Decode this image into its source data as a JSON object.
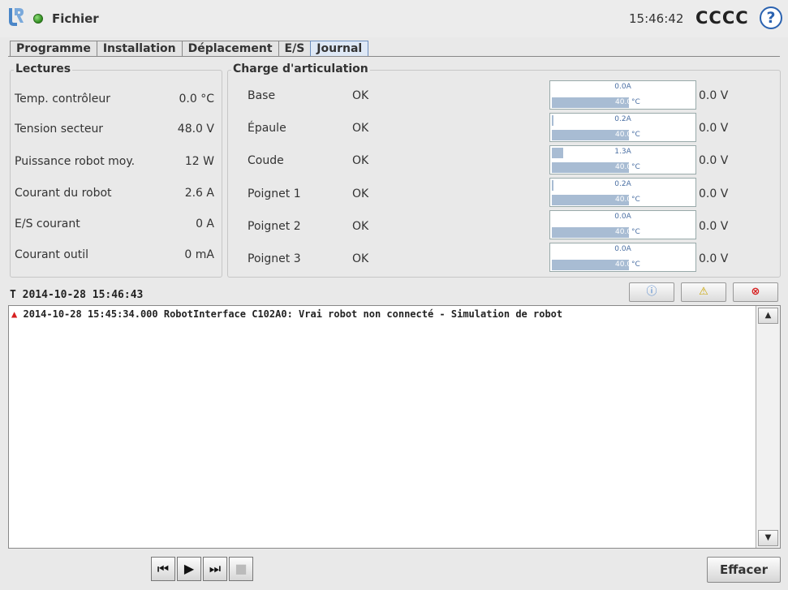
{
  "header": {
    "file_label": "Fichier",
    "clock": "15:46:42",
    "robot_name": "CCCC",
    "help_symbol": "?"
  },
  "tabs": [
    {
      "label": "Programme"
    },
    {
      "label": "Installation"
    },
    {
      "label": "Déplacement"
    },
    {
      "label": "E/S"
    },
    {
      "label": "Journal",
      "active": true
    }
  ],
  "readings": {
    "title": "Lectures",
    "items": [
      {
        "label": "Temp. contrôleur",
        "value": "0.0 °C"
      },
      {
        "label": "Tension secteur",
        "value": "48.0  V"
      },
      {
        "label": "Puissance robot moy.",
        "value": "12  W"
      },
      {
        "label": "Courant du robot",
        "value": "2.6  A"
      },
      {
        "label": "E/S courant",
        "value": "0  A"
      },
      {
        "label": "Courant outil",
        "value": "0 mA"
      }
    ]
  },
  "joints": {
    "title": "Charge d'articulation",
    "items": [
      {
        "name": "Base",
        "status": "OK",
        "current": "0.0A",
        "current_level": 0.0,
        "temp": "40.0",
        "temp_unit": "°C",
        "voltage": "0.0 V"
      },
      {
        "name": "Épaule",
        "status": "OK",
        "current": "0.2A",
        "current_level": 0.01,
        "temp": "40.0",
        "temp_unit": "°C",
        "voltage": "0.0 V"
      },
      {
        "name": "Coude",
        "status": "OK",
        "current": "1.3A",
        "current_level": 0.08,
        "temp": "40.0",
        "temp_unit": "°C",
        "voltage": "0.0 V"
      },
      {
        "name": "Poignet 1",
        "status": "OK",
        "current": "0.2A",
        "current_level": 0.01,
        "temp": "40.0",
        "temp_unit": "°C",
        "voltage": "0.0 V"
      },
      {
        "name": "Poignet 2",
        "status": "OK",
        "current": "0.0A",
        "current_level": 0.0,
        "temp": "40.0",
        "temp_unit": "°C",
        "voltage": "0.0 V"
      },
      {
        "name": "Poignet 3",
        "status": "OK",
        "current": "0.0A",
        "current_level": 0.0,
        "temp": "40.0",
        "temp_unit": "°C",
        "voltage": "0.0 V"
      }
    ]
  },
  "log": {
    "header": "T 2014-10-28 15:46:43",
    "filters": {
      "info": "ⓘ",
      "warning": "⚠",
      "error": "⊗"
    },
    "entries": [
      {
        "text": "2014-10-28 15:45:34.000 RobotInterface C102A0: Vrai robot non connecté - Simulation de robot",
        "level": "warning"
      }
    ]
  },
  "footer": {
    "clear_label": "Effacer"
  },
  "colors": {
    "accent": "#2a62b0",
    "status_ok": "#2e8b1e",
    "bar": "#a8bcd3",
    "error": "#d62020"
  }
}
